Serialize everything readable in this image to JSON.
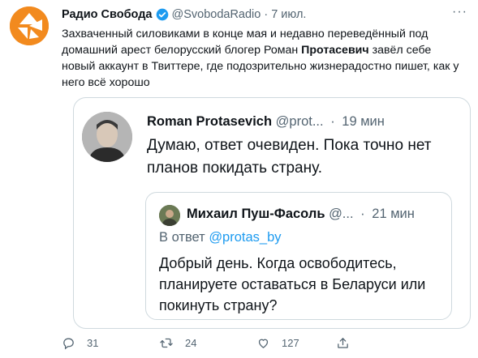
{
  "tweet": {
    "author_name": "Радио Свобода",
    "author_handle": "@SvobodaRadio",
    "separator": "·",
    "date": "7 июл.",
    "more": "···",
    "text_before": "Захваченный силовиками в конце мая и недавно переведённый под домашний арест белорусский блогер Роман ",
    "text_bold": "Протасевич",
    "text_after": " завёл себе новый аккаунт в Твиттере, где подозрительно жизнерадостно пишет, как у него всё хорошо"
  },
  "quoted": {
    "author_name": "Roman Protasevich",
    "author_handle": "@prot...",
    "separator": "·",
    "time": "19 мин",
    "text": "Думаю, ответ очевиден. Пока точно нет планов покидать страну.",
    "nested": {
      "author_name": "Михаил Пуш-Фасоль",
      "author_handle": "@...",
      "separator": "·",
      "time": "21 мин",
      "reply_prefix": "В ответ ",
      "reply_handle": "@protas_by",
      "text": "Добрый день. Когда освободитесь, планируете оставаться в Беларуси или покинуть страну?"
    }
  },
  "actions": {
    "replies": "31",
    "retweets": "24",
    "likes": "127"
  },
  "colors": {
    "accent": "#1d9bf0",
    "brand_orange": "#f28a1e",
    "muted": "#536471",
    "border": "#cfd9de"
  }
}
